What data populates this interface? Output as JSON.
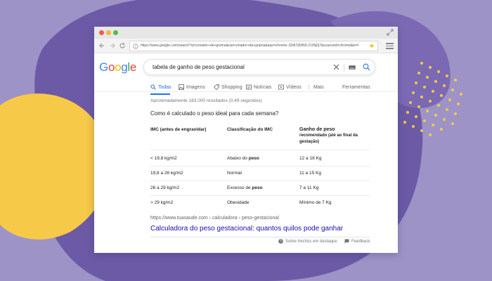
{
  "browser": {
    "url": "https://www.google.com/search?q=cortador+de+grama&oq=cortador+de+grama&aqs=chrome..69i57j69i59.2126j0j7&sourceid=chrome&ie=UTF-8"
  },
  "search": {
    "query": "tabela de ganho de peso gestacional"
  },
  "logo": {
    "letters": [
      "G",
      "o",
      "o",
      "g",
      "l",
      "e"
    ],
    "colors": [
      "#4285f4",
      "#ea4335",
      "#fbbc05",
      "#4285f4",
      "#34a853",
      "#ea4335"
    ]
  },
  "tabs": {
    "all": "Todas",
    "images": "Imagens",
    "shopping": "Shopping",
    "news": "Notícias",
    "videos": "Vídeos",
    "more": "Mais",
    "tools": "Ferramentas"
  },
  "results_count": "Aproximadamente 183.000 resultados (0,49 segundos)",
  "snippet": {
    "question": "Como é calculado o peso ideal para cada semana?",
    "headers": {
      "imc": "IMC (antes de engravidar)",
      "classification": "Classificação do IMC",
      "gain_title": "Ganho de peso",
      "gain_subtitle": "recomendado (até ao final da gestação)"
    },
    "rows": [
      {
        "imc": "< 19,8 kg/m2",
        "class_prefix": "Abaixo do ",
        "class_bold": "peso",
        "gain": "12 a 18 Kg"
      },
      {
        "imc": "19,8 a 26 kg/m2",
        "class_prefix": "Normal",
        "class_bold": "",
        "gain": "11 a 15 Kg"
      },
      {
        "imc": "26 a 29 kg/m2",
        "class_prefix": "Excesso de ",
        "class_bold": "peso",
        "gain": "7 a 11 Kg"
      },
      {
        "imc": "> 29 kg/m2",
        "class_prefix": "Obesidade",
        "class_bold": "",
        "gain": "Mínimo de 7 Kg"
      }
    ],
    "cite": "https://www.tuasaude.com › calculadora › peso-gestacional",
    "title": "Calculadora do peso gestacional: quantos quilos pode ganhar",
    "about": "Sobre trechos em destaque",
    "feedback": "Feedback"
  },
  "colors": {
    "background": "#9d93c7",
    "blob_purple": "#6c5aa6",
    "blob_yellow": "#f7c948",
    "link": "#1a0dab",
    "accent": "#1a73e8"
  }
}
